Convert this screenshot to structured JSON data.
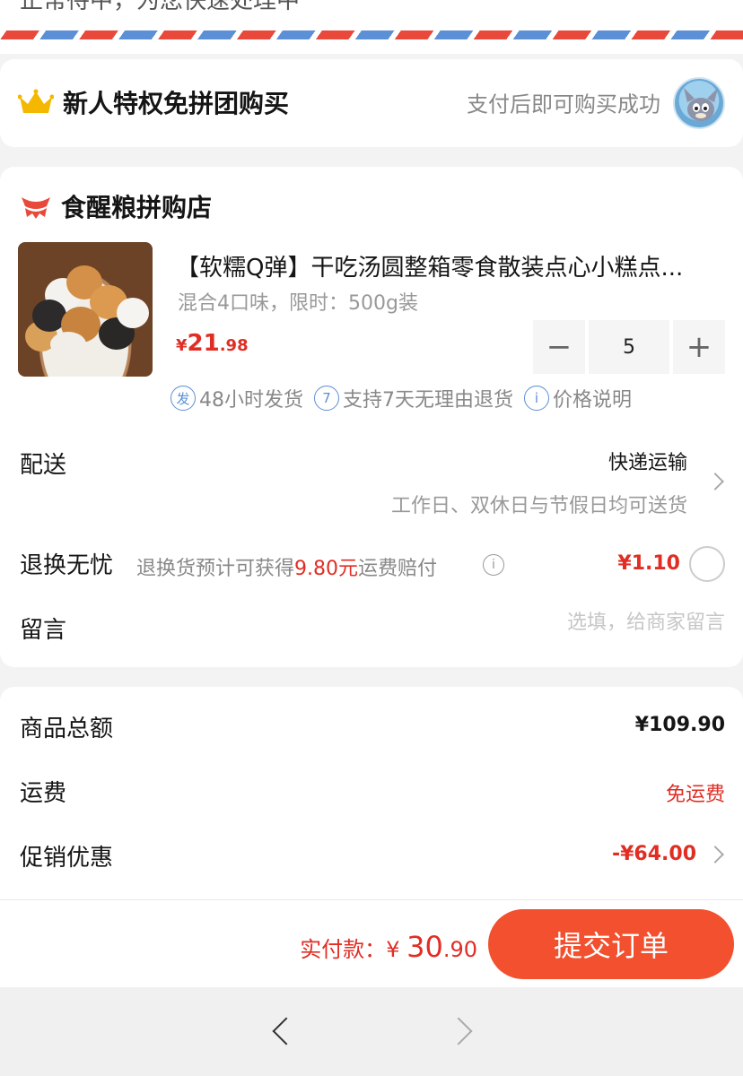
{
  "top": {
    "cut_text": "正常待中，为您快速处理中"
  },
  "privilege": {
    "title": "新人特权免拼团购买",
    "hint": "支付后即可购买成功",
    "crown_icon": "crown-icon",
    "accent": "#f5b800"
  },
  "store": {
    "name": "食醒粮拼购店",
    "icon": "store-icon"
  },
  "product": {
    "title": "【软糯Q弹】干吃汤圆整箱零食散装点心小糕点...",
    "spec": "混合4口味，限时：500g装",
    "price_currency": "¥",
    "price_int": "21",
    "price_dec": ".98",
    "quantity": "5",
    "minus": "−",
    "plus": "+"
  },
  "services": [
    {
      "icon": "发",
      "label": "48小时发货"
    },
    {
      "icon": "7",
      "label": "支持7天无理由退货"
    },
    {
      "icon": "i",
      "label": "价格说明"
    }
  ],
  "delivery": {
    "label": "配送",
    "method": "快递运输",
    "note": "工作日、双休日与节假日均可送货"
  },
  "return_worry_free": {
    "label": "退换无忧",
    "desc_prefix": "退换货预计可获得",
    "desc_amount": "9.80元",
    "desc_suffix": "运费赔付",
    "fee": "¥1.10"
  },
  "message": {
    "label": "留言",
    "placeholder": "选填，给商家留言"
  },
  "summary": {
    "goods_total_label": "商品总额",
    "goods_total": "¥109.90",
    "shipping_label": "运费",
    "shipping": "免运费",
    "promo_label": "促销优惠",
    "promo": "-¥64.00"
  },
  "footer": {
    "pay_label": "实付款：",
    "pay_currency": "¥",
    "pay_int": "30",
    "pay_dec": ".90",
    "submit_label": "提交订单"
  },
  "colors": {
    "brand_red": "#e02e24",
    "submit_orange": "#f2502e",
    "service_blue": "#5b8fd6"
  }
}
